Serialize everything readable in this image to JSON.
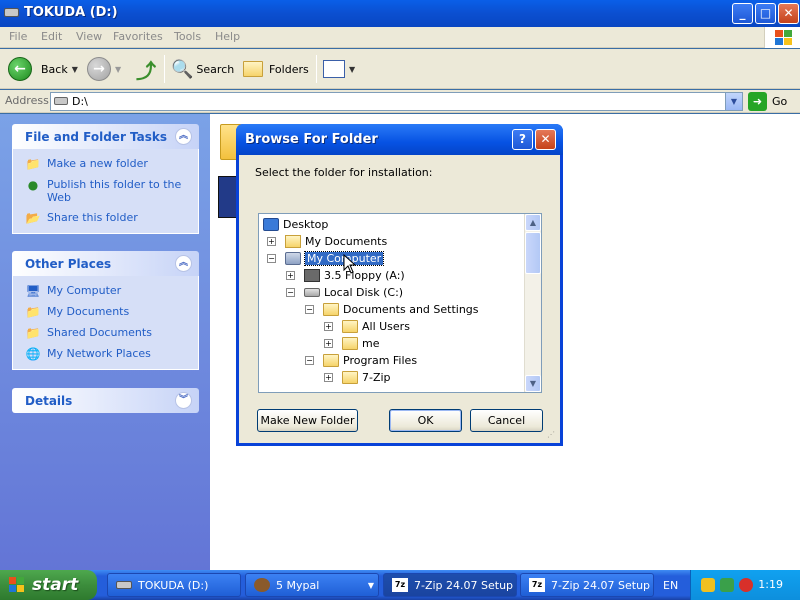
{
  "window": {
    "title": "TOKUDA (D:)",
    "min_label": "_",
    "max_label": "□",
    "close_label": "✕"
  },
  "menu": [
    "File",
    "Edit",
    "View",
    "Favorites",
    "Tools",
    "Help"
  ],
  "toolbar": {
    "back": "Back",
    "search": "Search",
    "folders": "Folders"
  },
  "address": {
    "label": "Address",
    "value": "D:\\",
    "go": "Go"
  },
  "tasks": {
    "file_folder": {
      "title": "File and Folder Tasks",
      "items": [
        "Make a new folder",
        "Publish this folder to the Web",
        "Share this folder"
      ]
    },
    "other_places": {
      "title": "Other Places",
      "items": [
        "My Computer",
        "My Documents",
        "Shared Documents",
        "My Network Places"
      ]
    },
    "details": {
      "title": "Details"
    }
  },
  "dialog": {
    "title": "Browse For Folder",
    "help_label": "?",
    "close_label": "✕",
    "instruction": "Select the folder for installation:",
    "tree": [
      {
        "label": "Desktop",
        "level": 0,
        "expander": "",
        "icon": "desktop-icon"
      },
      {
        "label": "My Documents",
        "level": 1,
        "expander": "+",
        "icon": "my-documents-icon"
      },
      {
        "label": "My Computer",
        "level": 1,
        "expander": "−",
        "icon": "my-computer-icon",
        "selected": true
      },
      {
        "label": "3.5 Floppy (A:)",
        "level": 2,
        "expander": "+",
        "icon": "floppy-icon"
      },
      {
        "label": "Local Disk (C:)",
        "level": 2,
        "expander": "−",
        "icon": "local-disk-icon"
      },
      {
        "label": "Documents and Settings",
        "level": 3,
        "expander": "−",
        "icon": "folder-icon"
      },
      {
        "label": "All Users",
        "level": 4,
        "expander": "+",
        "icon": "folder-icon"
      },
      {
        "label": "me",
        "level": 4,
        "expander": "+",
        "icon": "folder-icon"
      },
      {
        "label": "Program Files",
        "level": 3,
        "expander": "−",
        "icon": "folder-icon"
      },
      {
        "label": "7-Zip",
        "level": 4,
        "expander": "+",
        "icon": "folder-icon"
      }
    ],
    "buttons": {
      "new_folder": "Make New Folder",
      "ok": "OK",
      "cancel": "Cancel"
    }
  },
  "taskbar": {
    "start": "start",
    "tasks": [
      "TOKUDA (D:)",
      "5 Mypal",
      "7-Zip 24.07 Setup",
      "7-Zip 24.07 Setup"
    ],
    "lang": "EN",
    "clock": "1:19"
  },
  "colors": {
    "xp_blue": "#0842d8",
    "task_link": "#215dc6",
    "selection": "#316ac5",
    "taskbar": "#245edb",
    "start_green": "#3c8d3c"
  }
}
